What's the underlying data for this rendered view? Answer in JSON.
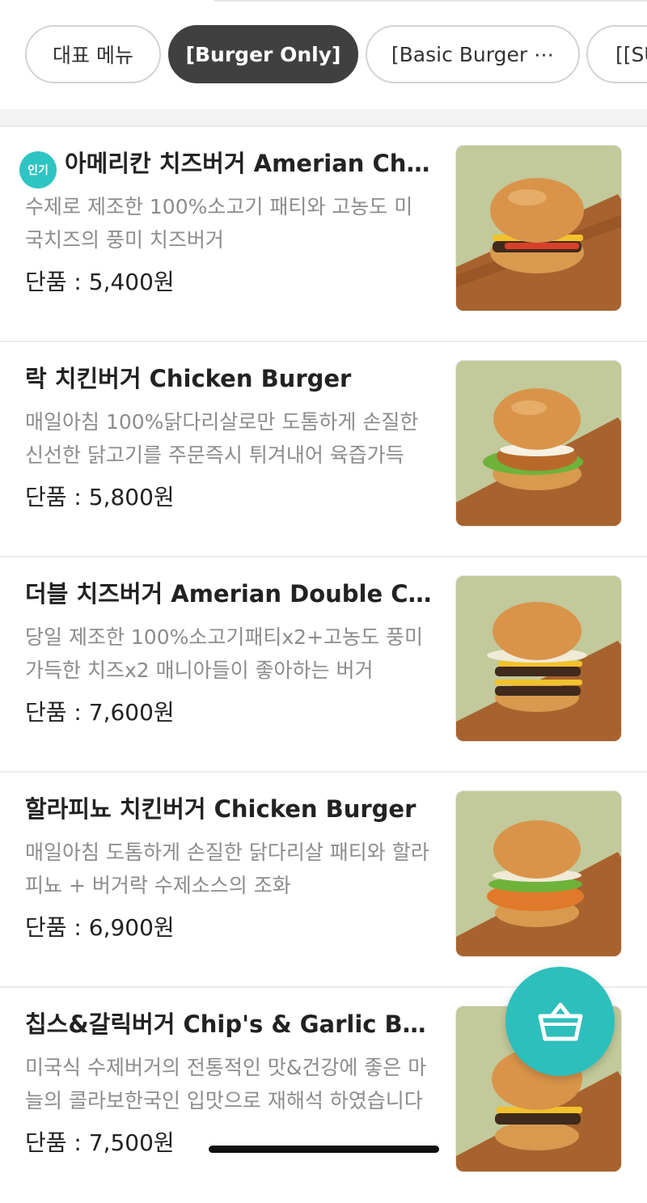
{
  "tabs": [
    {
      "label": "대표 메뉴"
    },
    {
      "label": "[Burger Only]"
    },
    {
      "label": "[Basic Burger ⋯"
    },
    {
      "label": "[[SU"
    }
  ],
  "menu_items": [
    {
      "badge": "인기",
      "title": "아메리칸 치즈버거 Amerian Cheese Burger",
      "desc": "수제로 제조한 100%소고기 패티와 고농도 미국치즈의 풍미 치즈버거",
      "price": "단품 : 5,400원"
    },
    {
      "title": "락 치킨버거 Chicken Burger",
      "desc": "매일아침 100%닭다리살로만 도톰하게 손질한 신선한 닭고기를 주문즉시 튀겨내어 육즙가득",
      "price": "단품 : 5,800원"
    },
    {
      "title": "더블 치즈버거 Amerian Double Cheese Burger",
      "desc": "당일 제조한 100%소고기패티x2+고농도 풍미가득한 치즈x2 매니아들이 좋아하는 버거",
      "price": "단품 : 7,600원"
    },
    {
      "title": "할라피뇨 치킨버거 Chicken Burger",
      "desc": "매일아침 도톰하게 손질한 닭다리살 패티와 할라피뇨 + 버거락 수제소스의 조화",
      "price": "단품 : 6,900원"
    },
    {
      "title": "칩스&갈릭버거 Chip's & Garlic Burger",
      "desc": "미국식 수제버거의 전통적인 맛&건강에 좋은 마늘의 콜라보한국인 입맛으로 재해석 하였습니다",
      "price": "단품 : 7,500원"
    }
  ],
  "cart": {
    "icon": "basket-icon"
  },
  "colors": {
    "accent": "#2dbfbc",
    "active_tab": "#404040"
  }
}
